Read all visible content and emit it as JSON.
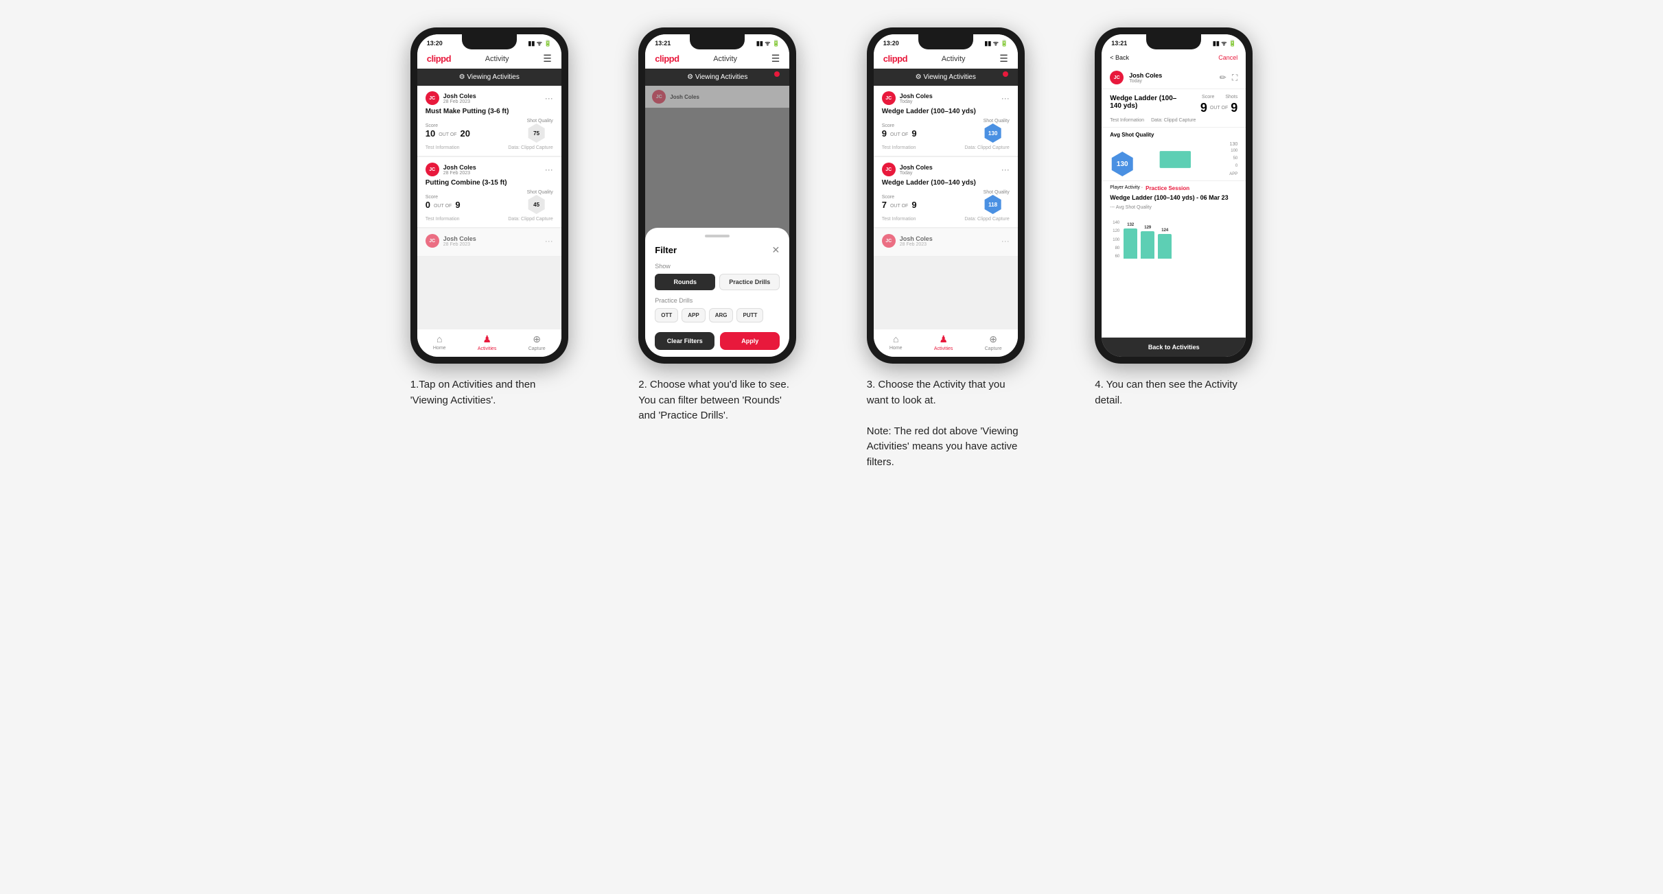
{
  "steps": [
    {
      "id": "step1",
      "caption": "1.Tap on Activities and then 'Viewing Activities'.",
      "statusBar": {
        "time": "13:20",
        "icons": "▮▮▮ ᯤ ⬛"
      },
      "nav": {
        "logo": "clippd",
        "title": "Activity",
        "menuIcon": "☰"
      },
      "viewingBanner": "⚙ Viewing Activities",
      "hasRedDot": false,
      "cards": [
        {
          "userName": "Josh Coles",
          "userDate": "28 Feb 2023",
          "title": "Must Make Putting (3-6 ft)",
          "scoreLabel": "Score",
          "shotsLabel": "Shots",
          "qualityLabel": "Shot Quality",
          "score": "10",
          "outOf": "OUT OF",
          "shots": "20",
          "quality": "75",
          "qualityBlue": false,
          "testInfo": "Test Information",
          "dataSource": "Data: Clippd Capture"
        },
        {
          "userName": "Josh Coles",
          "userDate": "28 Feb 2023",
          "title": "Putting Combine (3-15 ft)",
          "scoreLabel": "Score",
          "shotsLabel": "Shots",
          "qualityLabel": "Shot Quality",
          "score": "0",
          "outOf": "OUT OF",
          "shots": "9",
          "quality": "45",
          "qualityBlue": false,
          "testInfo": "Test Information",
          "dataSource": "Data: Clippd Capture"
        },
        {
          "userName": "Josh Coles",
          "userDate": "28 Feb 2023",
          "title": "",
          "scoreLabel": "",
          "shotsLabel": "",
          "qualityLabel": "",
          "score": "",
          "outOf": "",
          "shots": "",
          "quality": "",
          "qualityBlue": false,
          "testInfo": "",
          "dataSource": "",
          "partial": true
        }
      ],
      "bottomNav": [
        {
          "label": "Home",
          "icon": "⌂",
          "active": false
        },
        {
          "label": "Activities",
          "icon": "♟",
          "active": true
        },
        {
          "label": "Capture",
          "icon": "⊕",
          "active": false
        }
      ]
    },
    {
      "id": "step2",
      "caption": "2. Choose what you'd like to see. You can filter between 'Rounds' and 'Practice Drills'.",
      "statusBar": {
        "time": "13:21",
        "icons": "▮▮▮ ᯤ ⬛"
      },
      "nav": {
        "logo": "clippd",
        "title": "Activity",
        "menuIcon": "☰"
      },
      "viewingBanner": "⚙ Viewing Activities",
      "hasRedDot": true,
      "filter": {
        "dragHandle": true,
        "title": "Filter",
        "closeIcon": "✕",
        "showLabel": "Show",
        "toggles": [
          {
            "label": "Rounds",
            "active": true
          },
          {
            "label": "Practice Drills",
            "active": false
          }
        ],
        "practiceLabel": "Practice Drills",
        "chips": [
          "OTT",
          "APP",
          "ARG",
          "PUTT"
        ],
        "clearLabel": "Clear Filters",
        "applyLabel": "Apply"
      }
    },
    {
      "id": "step3",
      "caption": "3. Choose the Activity that you want to look at.\n\nNote: The red dot above 'Viewing Activities' means you have active filters.",
      "statusBar": {
        "time": "13:20",
        "icons": "▮▮▮ ᯤ ⬛"
      },
      "nav": {
        "logo": "clippd",
        "title": "Activity",
        "menuIcon": "☰"
      },
      "viewingBanner": "⚙ Viewing Activities",
      "hasRedDot": true,
      "cards": [
        {
          "userName": "Josh Coles",
          "userDate": "Today",
          "title": "Wedge Ladder (100–140 yds)",
          "scoreLabel": "Score",
          "shotsLabel": "Shots",
          "qualityLabel": "Shot Quality",
          "score": "9",
          "outOf": "OUT OF",
          "shots": "9",
          "quality": "130",
          "qualityBlue": true,
          "testInfo": "Test Information",
          "dataSource": "Data: Clippd Capture"
        },
        {
          "userName": "Josh Coles",
          "userDate": "Today",
          "title": "Wedge Ladder (100–140 yds)",
          "scoreLabel": "Score",
          "shotsLabel": "Shots",
          "qualityLabel": "Shot Quality",
          "score": "7",
          "outOf": "OUT OF",
          "shots": "9",
          "quality": "118",
          "qualityBlue": true,
          "testInfo": "Test Information",
          "dataSource": "Data: Clippd Capture"
        },
        {
          "userName": "Josh Coles",
          "userDate": "28 Feb 2023",
          "title": "",
          "scoreLabel": "",
          "shotsLabel": "",
          "qualityLabel": "",
          "score": "",
          "outOf": "",
          "shots": "",
          "quality": "",
          "qualityBlue": false,
          "partial": true
        }
      ],
      "bottomNav": [
        {
          "label": "Home",
          "icon": "⌂",
          "active": false
        },
        {
          "label": "Activities",
          "icon": "♟",
          "active": true
        },
        {
          "label": "Capture",
          "icon": "⊕",
          "active": false
        }
      ]
    },
    {
      "id": "step4",
      "caption": "4. You can then see the Activity detail.",
      "statusBar": {
        "time": "13:21",
        "icons": "▮▮▮ ᯤ ⬛"
      },
      "nav": {
        "backLabel": "< Back",
        "cancelLabel": "Cancel"
      },
      "user": {
        "name": "Josh Coles",
        "date": "Today"
      },
      "drillName": "Wedge Ladder (100–140 yds)",
      "scoreLabel": "Score",
      "shotsLabel": "Shots",
      "score": "9",
      "outOf": "OUT OF",
      "shots": "9",
      "infoLine1": "Test Information",
      "infoLine2": "Data: Clippd Capture",
      "avgQualityLabel": "Avg Shot Quality",
      "avgQualityValue": "130",
      "chartBarLabel": "130",
      "chartYLabels": [
        "100",
        "50",
        "0"
      ],
      "chartXLabel": "APP",
      "playerActivityPrefix": "Player Activity · ",
      "playerActivityValue": "Practice Session",
      "sessionTitle": "Wedge Ladder (100–140 yds) - 06 Mar 23",
      "sessionSubtitle": "--- Avg Shot Quality",
      "sessionBars": [
        {
          "value": 132,
          "label": ""
        },
        {
          "value": 129,
          "label": ""
        },
        {
          "value": 124,
          "label": ""
        }
      ],
      "backToActivities": "Back to Activities"
    }
  ]
}
